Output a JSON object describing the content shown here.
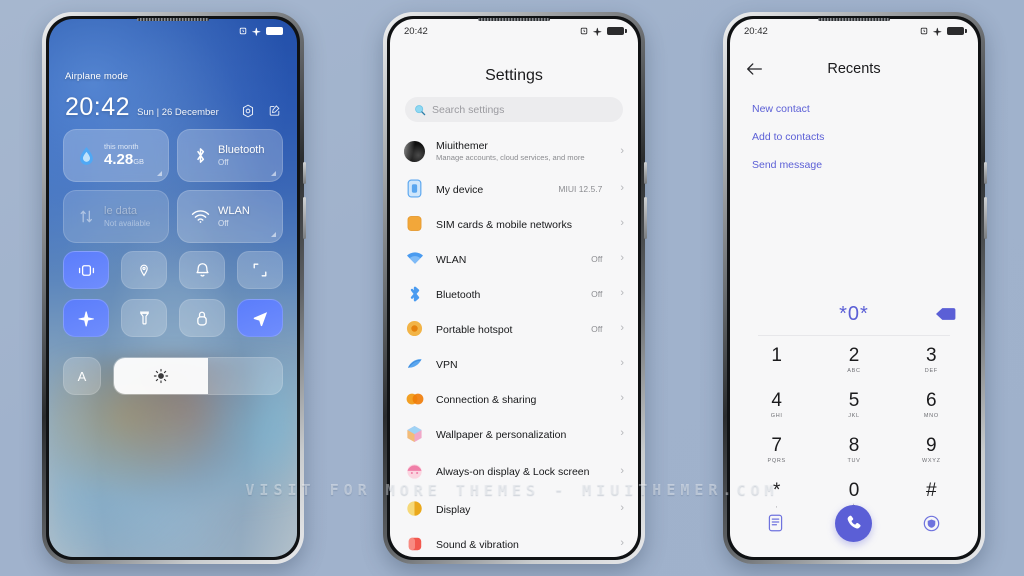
{
  "background_color": "#a3b4cd",
  "watermark": "VISIT FOR MORE THEMES - MIUITHEMER.COM",
  "control_center": {
    "status_bar": {
      "left_label": "Airplane mode",
      "icons": [
        "alarm-icon",
        "airplane-icon",
        "battery-icon"
      ]
    },
    "clock": {
      "time": "20:42",
      "date": "Sun | 26 December"
    },
    "clock_icons": [
      "settings-icon",
      "edit-icon"
    ],
    "big_tiles": [
      {
        "name": "data-usage",
        "top_label": "this month",
        "value": "4.28",
        "unit": "GB",
        "icon": "water-drop-icon",
        "dim": false
      },
      {
        "name": "bluetooth",
        "title": "Bluetooth",
        "subtitle": "Off",
        "icon": "bluetooth-icon",
        "dim": false
      },
      {
        "name": "mobile-data",
        "title": "le data",
        "subtitle": "Not available",
        "icon": "data-arrows-icon",
        "dim": true
      },
      {
        "name": "wlan",
        "title": "WLAN",
        "subtitle": "Off",
        "icon": "wifi-icon",
        "dim": false
      }
    ],
    "toggles": [
      {
        "name": "vibrate",
        "icon": "vibrate-icon",
        "on": true
      },
      {
        "name": "location",
        "icon": "location-pin-icon",
        "on": false
      },
      {
        "name": "ringer",
        "icon": "bell-icon",
        "on": false
      },
      {
        "name": "screenshot",
        "icon": "screenshot-icon",
        "on": false
      },
      {
        "name": "airplane-mode",
        "icon": "airplane-icon",
        "on": true
      },
      {
        "name": "flashlight",
        "icon": "flashlight-icon",
        "on": false
      },
      {
        "name": "lock",
        "icon": "lock-icon",
        "on": false
      },
      {
        "name": "gps",
        "icon": "navigation-arrow-icon",
        "on": true
      }
    ],
    "brightness": {
      "auto_label": "A",
      "icon": "brightness-icon",
      "level_percent": 56
    }
  },
  "settings": {
    "status_bar": {
      "time": "20:42",
      "icons": [
        "alarm-icon",
        "airplane-icon",
        "battery-icon"
      ]
    },
    "title": "Settings",
    "search": {
      "placeholder": "Search settings",
      "icon": "search-icon"
    },
    "account": {
      "name": "Miuithemer",
      "description": "Manage accounts, cloud services, and more",
      "icon": "avatar"
    },
    "items": [
      {
        "label": "My device",
        "value": "MIUI 12.5.7",
        "icon": "phone-icon",
        "color": "#7eb6f0"
      },
      {
        "label": "SIM cards & mobile networks",
        "value": "",
        "icon": "sim-icon",
        "color": "#f0a92e"
      },
      {
        "label": "WLAN",
        "value": "Off",
        "icon": "wifi-icon",
        "color": "#4a90f0"
      },
      {
        "label": "Bluetooth",
        "value": "Off",
        "icon": "bluetooth-icon",
        "color": "#4a90f0"
      },
      {
        "label": "Portable hotspot",
        "value": "Off",
        "icon": "hotspot-icon",
        "color": "#f0a020"
      },
      {
        "label": "VPN",
        "value": "",
        "icon": "vpn-icon",
        "color": "#4a90f0"
      },
      {
        "label": "Connection & sharing",
        "value": "",
        "icon": "sharing-icon",
        "color": "#f08a10"
      },
      {
        "label": "Wallpaper & personalization",
        "value": "",
        "icon": "wallpaper-icon",
        "color": "#c07ae0"
      },
      {
        "label": "Always-on display & Lock screen",
        "value": "",
        "icon": "aod-icon",
        "color": "#f07ab0"
      },
      {
        "label": "Display",
        "value": "",
        "icon": "display-icon",
        "color": "#f0c030"
      },
      {
        "label": "Sound & vibration",
        "value": "",
        "icon": "sound-icon",
        "color": "#f04a4a"
      }
    ],
    "chevron": "›"
  },
  "dialer": {
    "status_bar": {
      "time": "20:42",
      "icons": [
        "alarm-icon",
        "airplane-icon",
        "battery-icon"
      ]
    },
    "title": "Recents",
    "back_icon": "back-arrow-icon",
    "actions": [
      {
        "label": "New contact",
        "name": "new-contact-action"
      },
      {
        "label": "Add to contacts",
        "name": "add-to-contacts-action"
      },
      {
        "label": "Send message",
        "name": "send-message-action"
      }
    ],
    "entered_number": "*0*",
    "backspace_icon": "backspace-icon",
    "accent_color": "#5b5fd6",
    "keys": [
      {
        "digit": "1",
        "letters": ""
      },
      {
        "digit": "2",
        "letters": "ABC"
      },
      {
        "digit": "3",
        "letters": "DEF"
      },
      {
        "digit": "4",
        "letters": "GHI"
      },
      {
        "digit": "5",
        "letters": "JKL"
      },
      {
        "digit": "6",
        "letters": "MNO"
      },
      {
        "digit": "7",
        "letters": "PQRS"
      },
      {
        "digit": "8",
        "letters": "TUV"
      },
      {
        "digit": "9",
        "letters": "WXYZ"
      },
      {
        "digit": "*",
        "letters": ","
      },
      {
        "digit": "0",
        "letters": "+"
      },
      {
        "digit": "#",
        "letters": ""
      }
    ],
    "bottom_bar": [
      {
        "name": "keypad-list-icon"
      },
      {
        "name": "call-button"
      },
      {
        "name": "contacts-shield-icon"
      }
    ]
  }
}
